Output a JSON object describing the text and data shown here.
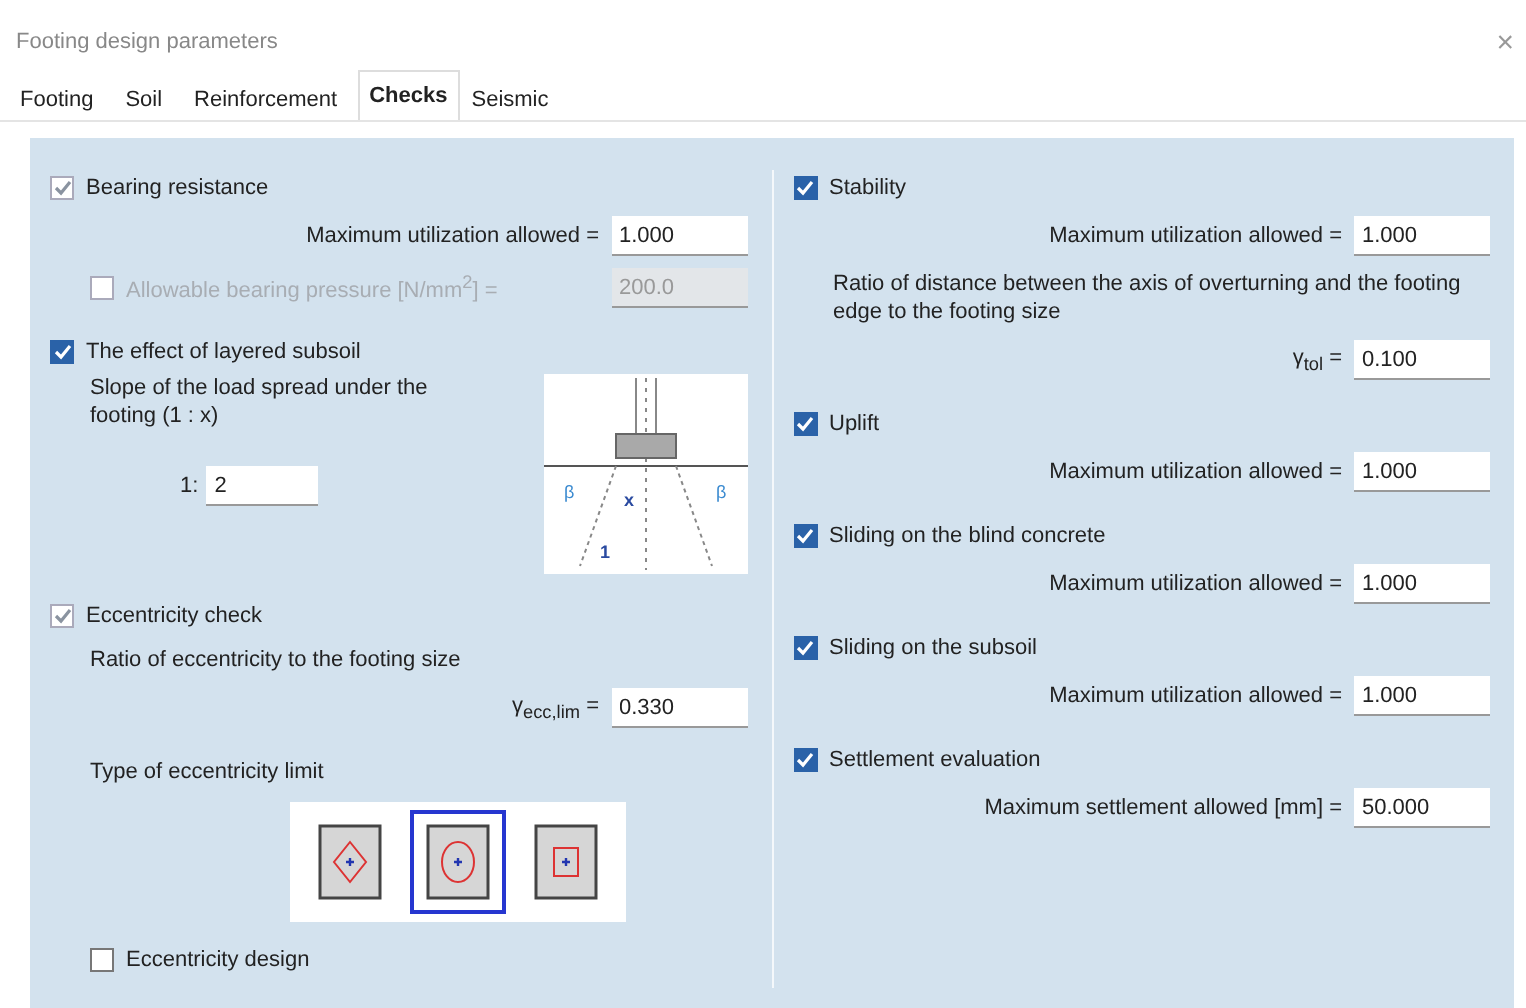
{
  "window": {
    "title": "Footing design parameters",
    "close": "×"
  },
  "tabs": [
    {
      "label": "Footing",
      "selected": false
    },
    {
      "label": "Soil",
      "selected": false
    },
    {
      "label": "Reinforcement",
      "selected": false
    },
    {
      "label": "Checks",
      "selected": true
    },
    {
      "label": "Seismic",
      "selected": false
    }
  ],
  "left": [
    {
      "label": "Bearing resistance",
      "checked": true,
      "disabled": true,
      "items": [
        {
          "kind": "field",
          "label": "Maximum utilization allowed =",
          "value": "1.000",
          "disabled": false
        },
        {
          "kind": "check_field",
          "label": "Allowable bearing pressure [N/mm$^{2}$] =",
          "value": "200.0",
          "checked": false,
          "disabled": true
        }
      ]
    },
    {
      "label": "The effect of layered subsoil",
      "checked": true,
      "disabled": false,
      "items": [
        {
          "kind": "slope",
          "label": "Slope of the load spread under the footing (1 : x)",
          "ratio_label": "1:",
          "value": "2",
          "diagram_labels": [
            "β",
            "x",
            "1",
            "β"
          ]
        }
      ]
    },
    {
      "label": "Eccentricity check",
      "checked": true,
      "disabled": true,
      "items": [
        {
          "kind": "note",
          "label": "Ratio of eccentricity to the footing size"
        },
        {
          "kind": "field",
          "label": "γ$_{ecc,lim}$ =",
          "value": "0.330",
          "disabled": false
        },
        {
          "kind": "limit_types",
          "label": "Type of eccentricity limit",
          "options": [
            {
              "kind": "diamond",
              "selected": false
            },
            {
              "kind": "ellipse",
              "selected": true
            },
            {
              "kind": "rectangle",
              "selected": false
            }
          ]
        },
        {
          "kind": "check",
          "label": "Eccentricity design",
          "checked": false,
          "disabled": false
        }
      ]
    }
  ],
  "right": [
    {
      "label": "Stability",
      "checked": true,
      "disabled": false,
      "items": [
        {
          "kind": "field",
          "label": "Maximum utilization allowed =",
          "value": "1.000",
          "disabled": false
        },
        {
          "kind": "note",
          "label": "Ratio of distance between the axis of overturning and the footing edge to the footing size"
        },
        {
          "kind": "field",
          "label": "γ$_{tol}$ =",
          "value": "0.100",
          "disabled": false
        }
      ]
    },
    {
      "label": "Uplift",
      "checked": true,
      "disabled": false,
      "items": [
        {
          "kind": "field",
          "label": "Maximum utilization allowed =",
          "value": "1.000",
          "disabled": false
        }
      ]
    },
    {
      "label": "Sliding on the blind concrete",
      "checked": true,
      "disabled": false,
      "items": [
        {
          "kind": "field",
          "label": "Maximum utilization allowed =",
          "value": "1.000",
          "disabled": false
        }
      ]
    },
    {
      "label": "Sliding on the subsoil",
      "checked": true,
      "disabled": false,
      "items": [
        {
          "kind": "field",
          "label": "Maximum utilization allowed =",
          "value": "1.000",
          "disabled": false
        }
      ]
    },
    {
      "label": "Settlement evaluation",
      "checked": true,
      "disabled": false,
      "items": [
        {
          "kind": "field",
          "label": "Maximum settlement allowed [mm] =",
          "value": "50.000",
          "disabled": false
        }
      ]
    }
  ]
}
